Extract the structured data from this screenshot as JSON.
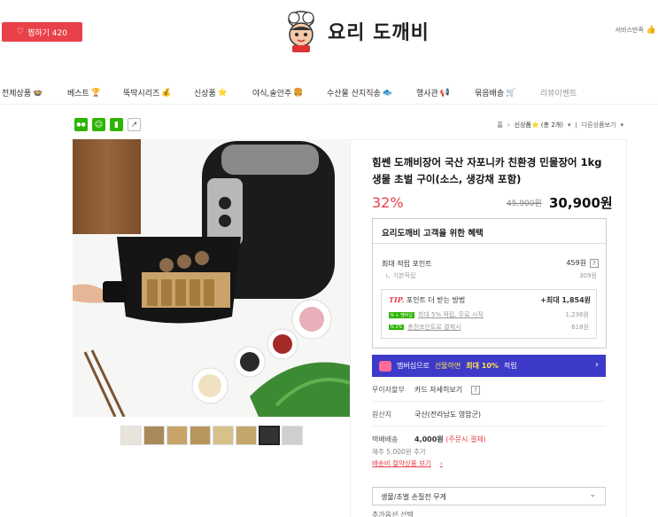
{
  "header": {
    "like_label": "찜하기 420",
    "logo_text": "요리 도깨비",
    "service_label": "서비스만족"
  },
  "nav": {
    "items": [
      {
        "label": "전체상품",
        "emoji": "🍲"
      },
      {
        "label": "베스트",
        "emoji": "🏆"
      },
      {
        "label": "뚝딱시리즈",
        "emoji": "💰"
      },
      {
        "label": "신상품",
        "emoji": "⭐"
      },
      {
        "label": "야식,술안주",
        "emoji": "🍔"
      },
      {
        "label": "수산물 산지직송",
        "emoji": "🐟"
      },
      {
        "label": "행사관",
        "emoji": "📢"
      },
      {
        "label": "묶음배송",
        "emoji": "🛒"
      },
      {
        "label": "리뷰이벤트",
        "emoji": ""
      }
    ]
  },
  "share": {
    "icons": [
      "chat-icon",
      "share-icon",
      "bookmark-icon",
      "external-icon"
    ]
  },
  "breadcrumb": {
    "home": "홈",
    "category": "신상품⭐ (총 2개)",
    "dropdown": "다른상품보기"
  },
  "product": {
    "title": "힘쎈 도깨비장어 국산 자포니카 친환경 민물장어 1kg 생물 초벌 구이(소스, 생강채 포함)",
    "discount": "32%",
    "original_price": "45,900원",
    "price": "30,900원"
  },
  "benefit": {
    "heading": "요리도깨비 고객을 위한 혜택",
    "max_points_label": "최대 적립 포인트",
    "max_points_value": "459원",
    "basic_label": "기본적립",
    "basic_value": "309원",
    "tip_label": "TIP.",
    "tip_text": "포인트 더 받는 방법",
    "tip_max": "+최대 1,854원",
    "tip_rows": [
      {
        "badge": "N + 멤버십",
        "label": "최대 5% 적립, 무료 시작",
        "value": "1,236원"
      },
      {
        "badge": "N 2%",
        "label": "충전포인트로 결제시",
        "value": "618원"
      }
    ]
  },
  "member_banner": {
    "text_prefix": "멤버십으로",
    "text_mid": "선물하면",
    "text_bold": "최대 10%",
    "text_suffix": "적립"
  },
  "details": {
    "installment_label": "무이자할부",
    "installment_value": "카드 자세히보기",
    "origin_label": "원산지",
    "origin_value": "국산(전라남도 영암군)",
    "shipping_label": "택배배송",
    "shipping_value": "4,000원",
    "shipping_note": "(주문시 결제)",
    "shipping_extra": "제주 5,000원 추가",
    "shipping_link": "배송비 절약상품 보기"
  },
  "option": {
    "select_label": "생물/초벌 손질전 무게",
    "add_label": "추가옵션 선택"
  },
  "colors": {
    "accent_red": "#e94149",
    "member_blue": "#3e3ac9",
    "naver_green": "#2db400"
  }
}
